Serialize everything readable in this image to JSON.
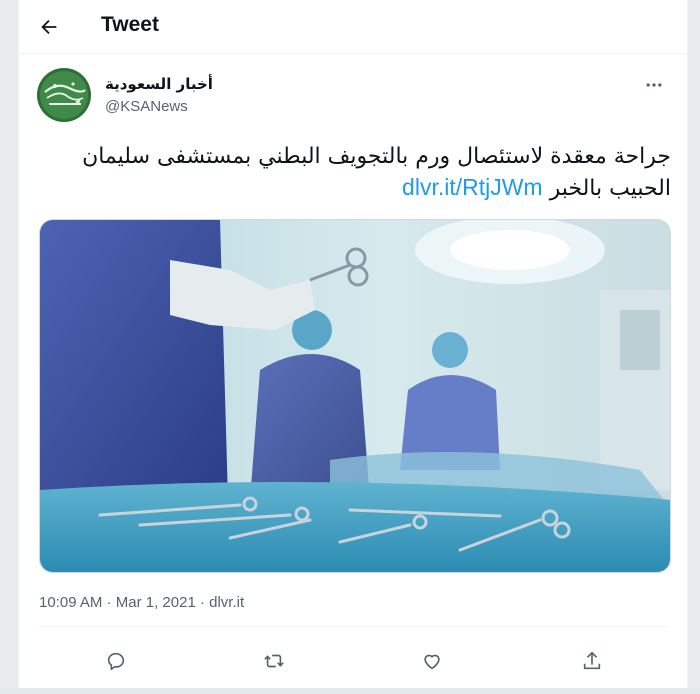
{
  "header": {
    "title": "Tweet",
    "back_icon": "arrow-left-icon"
  },
  "tweet": {
    "author_name": "أخبار السعودية",
    "author_handle": "@KSANews",
    "text": "جراحة معقدة لاستئصال ورم بالتجويف البطني بمستشفى سليمان الحبيب بالخبر ",
    "link": "dlvr.it/RtjJWm",
    "time": "10:09 AM",
    "separator": "·",
    "date": "Mar 1, 2021",
    "source": "dlvr.it",
    "media_alt": "surgeons in operating room with surgical instruments"
  },
  "actions": [
    {
      "name": "reply",
      "icon": "reply-icon"
    },
    {
      "name": "retweet",
      "icon": "retweet-icon"
    },
    {
      "name": "like",
      "icon": "heart-icon"
    },
    {
      "name": "share",
      "icon": "share-icon"
    }
  ],
  "colors": {
    "accent": "#1d9bf0",
    "text": "#0f1419",
    "muted": "#536471"
  }
}
